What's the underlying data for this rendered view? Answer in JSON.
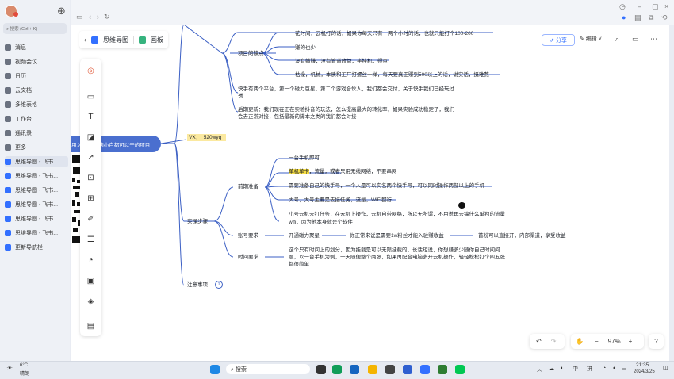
{
  "sidebar": {
    "search_placeholder": "搜索 (Ctrl + K)",
    "items": [
      {
        "label": "消息",
        "color": "#6b7280"
      },
      {
        "label": "视频会议",
        "color": "#6b7280"
      },
      {
        "label": "日历",
        "color": "#6b7280"
      },
      {
        "label": "云文档",
        "color": "#6b7280"
      },
      {
        "label": "多维表格",
        "color": "#6b7280"
      },
      {
        "label": "工作台",
        "color": "#6b7280"
      },
      {
        "label": "通讯录",
        "color": "#6b7280"
      },
      {
        "label": "更多",
        "color": "#6b7280"
      },
      {
        "label": "思维导图 - 飞书...",
        "color": "#3370ff",
        "selected": true
      },
      {
        "label": "思维导图 - 飞书...",
        "color": "#3370ff"
      },
      {
        "label": "思维导图 - 飞书...",
        "color": "#3370ff"
      },
      {
        "label": "思维导图 - 飞书...",
        "color": "#3370ff"
      },
      {
        "label": "思维导图 - 飞书...",
        "color": "#3370ff"
      },
      {
        "label": "思维导图 - 飞书...",
        "color": "#3370ff"
      },
      {
        "label": "更新导航栏",
        "color": "#3370ff"
      }
    ]
  },
  "header": {
    "tab_mindmap": "思维导图",
    "tab_board": "画板",
    "share_label": "分享",
    "edit_label": "编辑"
  },
  "mindmap": {
    "root_label": "用入 一个电脑小白都可以干的项目",
    "vx_label": "VX：_520wyq_",
    "project_cons": "项目的缺点",
    "cons": [
      "花时间，云机打的话，如果你每天只有一两个小时的话，也就只能打个100-200",
      "赚的也少",
      "没有躺赚，没有管道收益，半挂机，得点",
      "枯燥，机械，本质和工厂打螺丝一样，每天要真正赚到500以上的话，说实话，挺难熬"
    ],
    "platform_note": "快手有两个平台，第一个磁力巨星，第二个游戏合伙人，我们都会交付，关于快手我们已经玩过",
    "platform_note_2": "透",
    "later_note": "后期更新：我们现在正在实验抖音的玩法，怎么提高最大的转化率，如果实验成功稳定了，我们",
    "later_note_2": "会去正常对接，包括最新的脚本之类的我们都会对接",
    "steps": "实操步骤",
    "prep": "前期准备",
    "prep_items": [
      "一台手机即可",
      "单机单卡，流量，或者只用无线网络，不要串网",
      "需要准备自己的快手号，一个人是可以实名两个快手号，可以同时操作两部以上的手机",
      "大号，大号主要是去接任务，流量，WiFi都行",
      "小号云机去打任务，在云机上操作，云机自带网络，所以无所谓，不用说再去搞什么单独的流量",
      "wifi，因为他本身就是个软件"
    ],
    "prep_hl": "单机单卡",
    "prep_item2_rest": "，流量，或者只用无线网络，不要串网",
    "account": "账号要求",
    "account_a": "开通磁力聚星",
    "account_b": "你正常来说是需要1w粉丝才能入驻赚收益",
    "account_c": "首粉可以直接开，内部渠道，享受收益",
    "time_req": "时间要求",
    "time_text_1": "这个只有时间上的划分，因为挂载是可以无限挂载的，长话短说，你想赚多少随你自己时间问",
    "time_text_2": "题，以一台手机为例，一天随便整个两张，如果再配合电脑多开云机操作，轻轻松松打个四五张",
    "time_text_3": "都很简单",
    "notes": "注意事项",
    "notes_badge": "1"
  },
  "zoom": {
    "value": "97%"
  },
  "taskbar": {
    "weather_temp": "6°C",
    "weather_desc": "晴朗",
    "search": "搜索",
    "ime": "中",
    "ime2": "拼",
    "time": "21:35",
    "date": "2024/3/25"
  },
  "colors": {
    "accent": "#3370ff",
    "root": "#4a6fcf",
    "highlight": "#f8e045"
  }
}
